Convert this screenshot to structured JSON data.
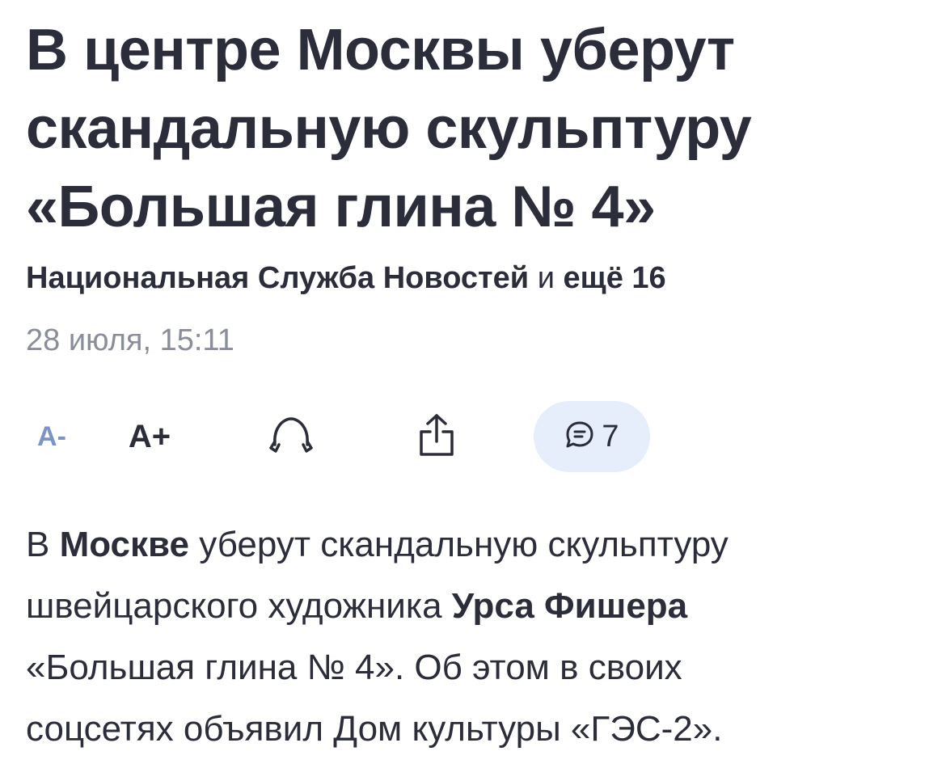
{
  "article": {
    "headline_lines": [
      "В центре Москвы уберут",
      "скандальную скульптуру",
      "«Большая глина № 4»"
    ],
    "source_name": "Национальная Служба Новостей",
    "source_and": "и",
    "source_more": "ещё 16",
    "date": "28 июля, 15:11"
  },
  "toolbar": {
    "font_decrease_label": "A-",
    "font_increase_label": "A+",
    "listen_icon": "headphones-icon",
    "share_icon": "share-icon",
    "comment_icon": "comment-bubble-icon",
    "comments_count": "7",
    "accent_color": "#e6eefc"
  },
  "body": {
    "l1_a": "В ",
    "l1_bold": "Москве",
    "l1_b": " уберут скандальную скульптуру",
    "l2_a": "швейцарского художника ",
    "l2_bold": "Урса Фишера",
    "l3": "«Большая глина № 4». Об этом в своих",
    "l4": "соцсетях объявил Дом культуры «ГЭС-2»."
  }
}
